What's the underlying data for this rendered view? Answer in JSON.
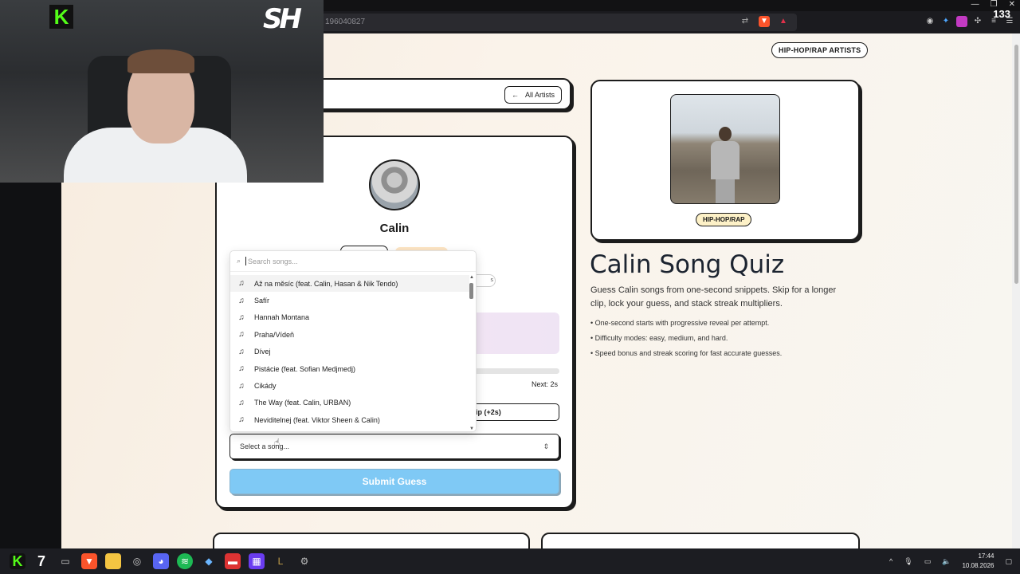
{
  "browser": {
    "url": "196040827",
    "counter": "133"
  },
  "page": {
    "top_badge": "HIP-HOP/RAP ARTISTS",
    "back_button": "All Artists",
    "artist_name": "Calin",
    "diff_pill_text": "s",
    "next_label": "Next: 2s",
    "skip_button": "ip (+2s)",
    "select_placeholder": "Select a song...",
    "submit_label": "Submit Guess",
    "genre_badge": "HIP-HOP/RAP",
    "quiz_title": "Calin Song Quiz",
    "quiz_description": "Guess Calin songs from one-second snippets. Skip for a longer clip, lock your guess, and stack streak multipliers.",
    "bullets": [
      "• One-second starts with progressive reveal per attempt.",
      "• Difficulty modes: easy, medium, and hard.",
      "• Speed bonus and streak scoring for fast accurate guesses."
    ]
  },
  "dropdown": {
    "search_placeholder": "Search songs...",
    "songs": [
      "Až na měsíc (feat. Calin, Hasan & Nik Tendo)",
      "Safír",
      "Hannah Montana",
      "Praha/Vídeň",
      "Dívej",
      "Pistácie (feat. Sofian Medjmedj)",
      "Cikády",
      "The Way (feat. Calin, URBAN)",
      "Neviditelnej (feat. Viktor Sheen & Calin)"
    ]
  },
  "taskbar": {
    "time": "17:44",
    "date": "10.08.2026"
  },
  "icons": {
    "back": "arrow-left-icon",
    "search": "search-icon",
    "song": "music-note-icon",
    "chevron": "chevron-updown-icon"
  },
  "colors": {
    "accent_blue": "#7fc9f5",
    "kick_green": "#53fc18",
    "badge_yellow": "#fdf1c7"
  }
}
